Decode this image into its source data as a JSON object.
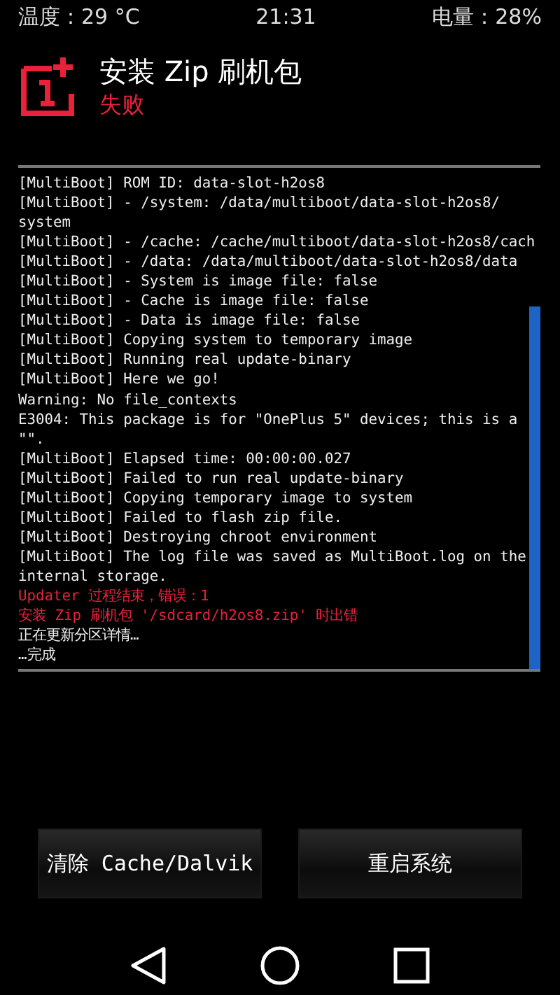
{
  "status_bar": {
    "temperature": "温度：29 °C",
    "time": "21:31",
    "battery": "电量：28%"
  },
  "header": {
    "title": "安装 Zip 刷机包",
    "status": "失败"
  },
  "log": {
    "lines": [
      {
        "kind": "normal",
        "text": "[MultiBoot] ROM ID: data-slot-h2os8"
      },
      {
        "kind": "normal",
        "text": "[MultiBoot] - /system: /data/multiboot/data-slot-h2os8/"
      },
      {
        "kind": "normal",
        "text": "system"
      },
      {
        "kind": "normal",
        "text": "[MultiBoot] - /cache: /cache/multiboot/data-slot-h2os8/cach"
      },
      {
        "kind": "normal",
        "text": "[MultiBoot] - /data: /data/multiboot/data-slot-h2os8/data"
      },
      {
        "kind": "normal",
        "text": "[MultiBoot] - System is image file: false"
      },
      {
        "kind": "normal",
        "text": "[MultiBoot] - Cache is image file: false"
      },
      {
        "kind": "normal",
        "text": "[MultiBoot] - Data is image file: false"
      },
      {
        "kind": "normal",
        "text": "[MultiBoot] Copying system to temporary image"
      },
      {
        "kind": "normal",
        "text": "[MultiBoot] Running real update-binary"
      },
      {
        "kind": "normal",
        "text": "[MultiBoot] Here we go!"
      },
      {
        "kind": "normal",
        "text": "Warning: No file_contexts"
      },
      {
        "kind": "normal",
        "text": "E3004: This package is for \"OnePlus 5\" devices; this is a"
      },
      {
        "kind": "normal",
        "text": "\"\"."
      },
      {
        "kind": "normal",
        "text": "[MultiBoot] Elapsed time: 00:00:00.027"
      },
      {
        "kind": "normal",
        "text": "[MultiBoot] Failed to run real update-binary"
      },
      {
        "kind": "normal",
        "text": "[MultiBoot] Copying temporary image to system"
      },
      {
        "kind": "normal",
        "text": "[MultiBoot] Failed to flash zip file."
      },
      {
        "kind": "normal",
        "text": "[MultiBoot] Destroying chroot environment"
      },
      {
        "kind": "normal",
        "text": "[MultiBoot] The log file was saved as MultiBoot.log on the"
      },
      {
        "kind": "normal",
        "text": "internal storage."
      },
      {
        "kind": "error",
        "text": "Updater 过程结束，错误：1"
      },
      {
        "kind": "error",
        "text": "安装 Zip 刷机包 '/sdcard/h2os8.zip' 时出错"
      },
      {
        "kind": "normal",
        "text": "正在更新分区详情…"
      },
      {
        "kind": "normal",
        "text": "…完成"
      }
    ]
  },
  "buttons": [
    {
      "label": "清除 Cache/Dalvik"
    },
    {
      "label": "重启系统"
    }
  ]
}
